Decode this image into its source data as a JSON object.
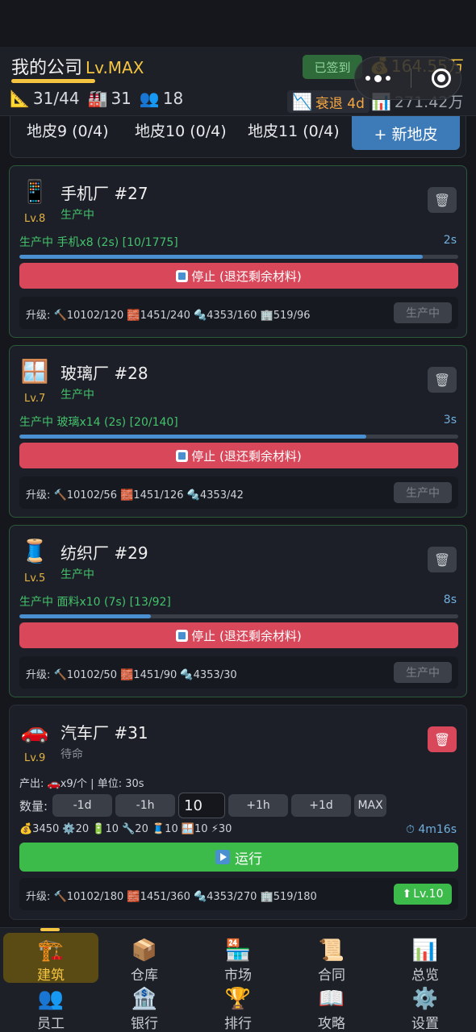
{
  "header": {
    "company_name": "我的公司",
    "level": "Lv.MAX",
    "signed_label": "已签到",
    "money": "164.55万",
    "land_usage": "31/44",
    "factory_count": "31",
    "employee_count": "18",
    "recession_label": "衰退 4d",
    "assets": "271.42万"
  },
  "land_tabs": {
    "tab1": "地皮9 (0/4)",
    "tab2": "地皮10 (0/4)",
    "tab3": "地皮11 (0/4)",
    "new_land": "+ 新地皮"
  },
  "factories": [
    {
      "icon": "📱",
      "level": "Lv.8",
      "name": "手机厂 #27",
      "status": "生产中",
      "production": "生产中 手机x8 (2s) [10/1775]",
      "time": "2s",
      "progress": 0.92,
      "stop_label": "停止 (退还剩余材料)",
      "upgrade": "升级: 🔨10102/120 🧱1451/240 🔩4353/160 🏢519/96",
      "upgrade_btn": "生产中"
    },
    {
      "icon": "🪟",
      "level": "Lv.7",
      "name": "玻璃厂 #28",
      "status": "生产中",
      "production": "生产中 玻璃x14 (2s) [20/140]",
      "time": "3s",
      "progress": 0.79,
      "stop_label": "停止 (退还剩余材料)",
      "upgrade": "升级: 🔨10102/56 🧱1451/126 🔩4353/42",
      "upgrade_btn": "生产中"
    },
    {
      "icon": "🧵",
      "level": "Lv.5",
      "name": "纺织厂 #29",
      "status": "生产中",
      "production": "生产中 面料x10 (7s) [13/92]",
      "time": "8s",
      "progress": 0.3,
      "stop_label": "停止 (退还剩余材料)",
      "upgrade": "升级: 🔨10102/50 🧱1451/90 🔩4353/30",
      "upgrade_btn": "生产中"
    }
  ],
  "car_factory": {
    "icon": "🚗",
    "level": "Lv.9",
    "name": "汽车厂 #31",
    "status": "待命",
    "output": "产出: 🚗x9/个 | 单位: 30s",
    "qty_label": "数量:",
    "btn_minus_1d": "-1d",
    "btn_minus_1h": "-1h",
    "qty_value": "10",
    "btn_plus_1h": "+1h",
    "btn_plus_1d": "+1d",
    "btn_max": "MAX",
    "materials": "💰3450 ⚙️20 🔋10 🔧20 🧵10 🪟10 ⚡30",
    "timer": "⏱ 4m16s",
    "run_label": "运行",
    "upgrade": "升级: 🔨10102/180 🧱1451/360 🔩4353/270 🏢519/180",
    "upgrade_btn": "Lv.10"
  },
  "nav": [
    {
      "icon": "🏗️",
      "label": "建筑"
    },
    {
      "icon": "📦",
      "label": "仓库"
    },
    {
      "icon": "🏪",
      "label": "市场"
    },
    {
      "icon": "📜",
      "label": "合同"
    },
    {
      "icon": "📊",
      "label": "总览"
    },
    {
      "icon": "👥",
      "label": "员工"
    },
    {
      "icon": "🏦",
      "label": "银行"
    },
    {
      "icon": "🏆",
      "label": "排行"
    },
    {
      "icon": "📖",
      "label": "攻略"
    },
    {
      "icon": "⚙️",
      "label": "设置"
    }
  ]
}
